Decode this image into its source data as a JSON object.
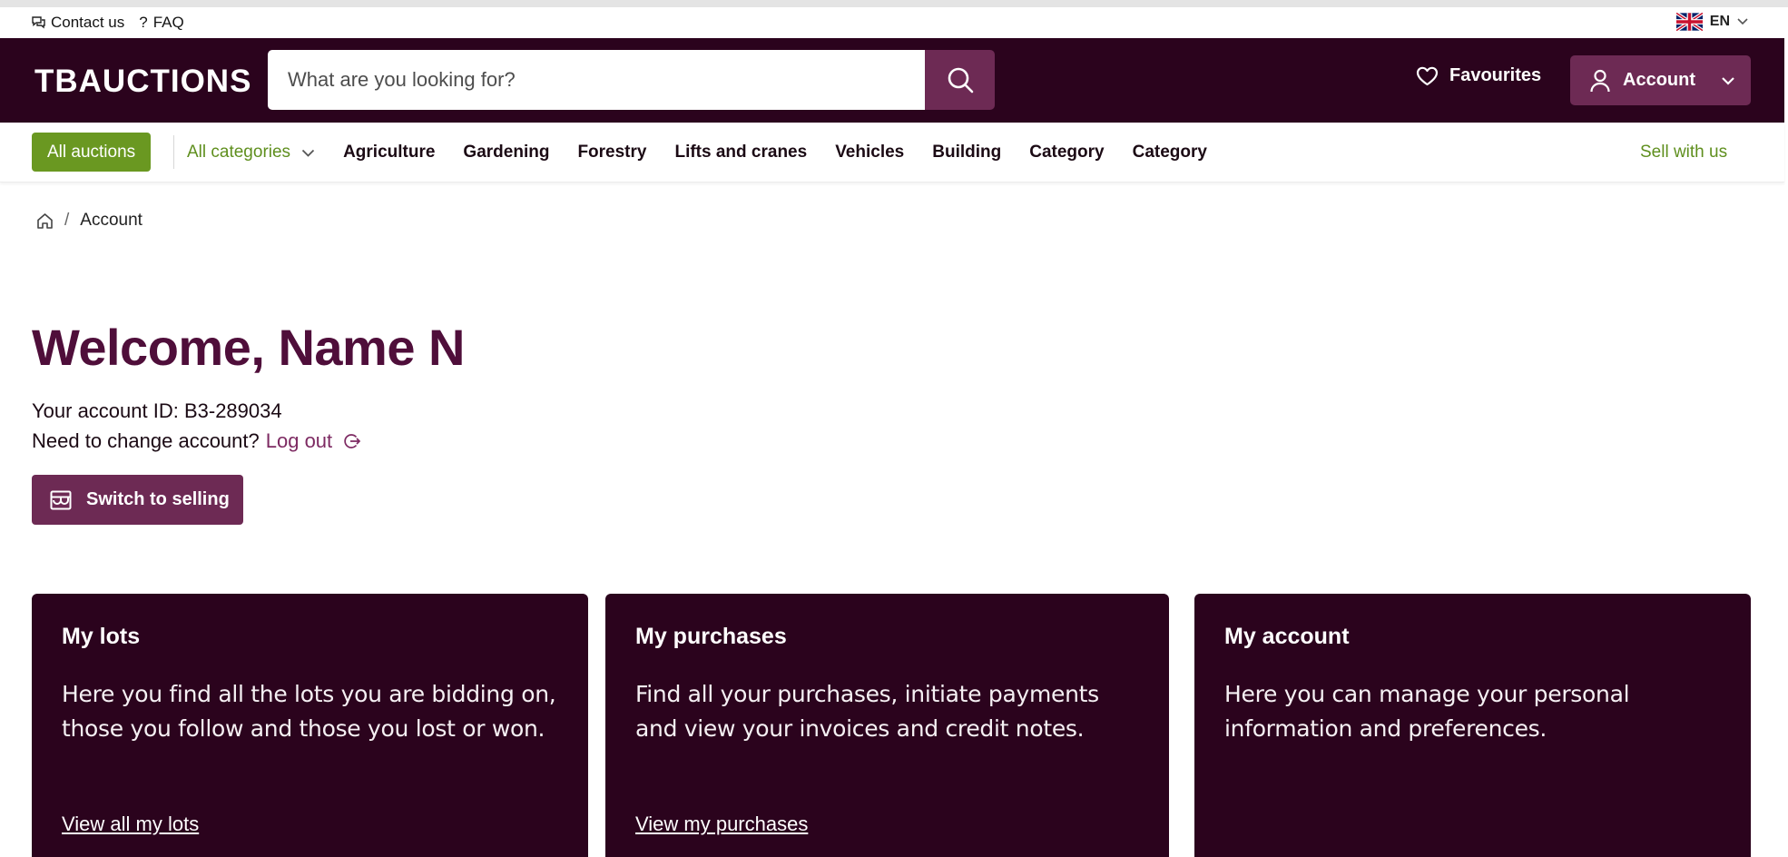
{
  "util": {
    "contact": "Contact us",
    "faq_icon": "?",
    "faq": "FAQ",
    "language": "EN"
  },
  "header": {
    "logo": "TBAUCTIONS",
    "search_placeholder": "What are you looking for?",
    "favourites": "Favourites",
    "account": "Account"
  },
  "nav": {
    "all_auctions": "All auctions",
    "all_categories": "All categories",
    "items": [
      "Agriculture",
      "Gardening",
      "Forestry",
      "Lifts and cranes",
      "Vehicles",
      "Building",
      "Category",
      "Category"
    ],
    "sell": "Sell with us"
  },
  "breadcrumb": {
    "separator": "/",
    "current": "Account"
  },
  "main": {
    "welcome": "Welcome, Name N",
    "account_id": "Your account ID: B3-289034",
    "change_text": "Need to change account?",
    "logout": "Log out",
    "switch": "Switch to selling"
  },
  "cards": [
    {
      "title": "My lots",
      "text": "Here you find all the lots you are bidding on, those you follow and those you lost or won.",
      "link": "View all my lots"
    },
    {
      "title": "My purchases",
      "text": "Find all your purchases, initiate payments and view your invoices and credit notes.",
      "link": "View my purchases"
    },
    {
      "title": "My account",
      "text": "Here you can manage your personal information and preferences.",
      "link": ""
    }
  ],
  "colors": {
    "brand_dark": "#2b031d",
    "brand_purple": "#6d2a54",
    "heading": "#4f0e3a",
    "green": "#6a9821"
  }
}
